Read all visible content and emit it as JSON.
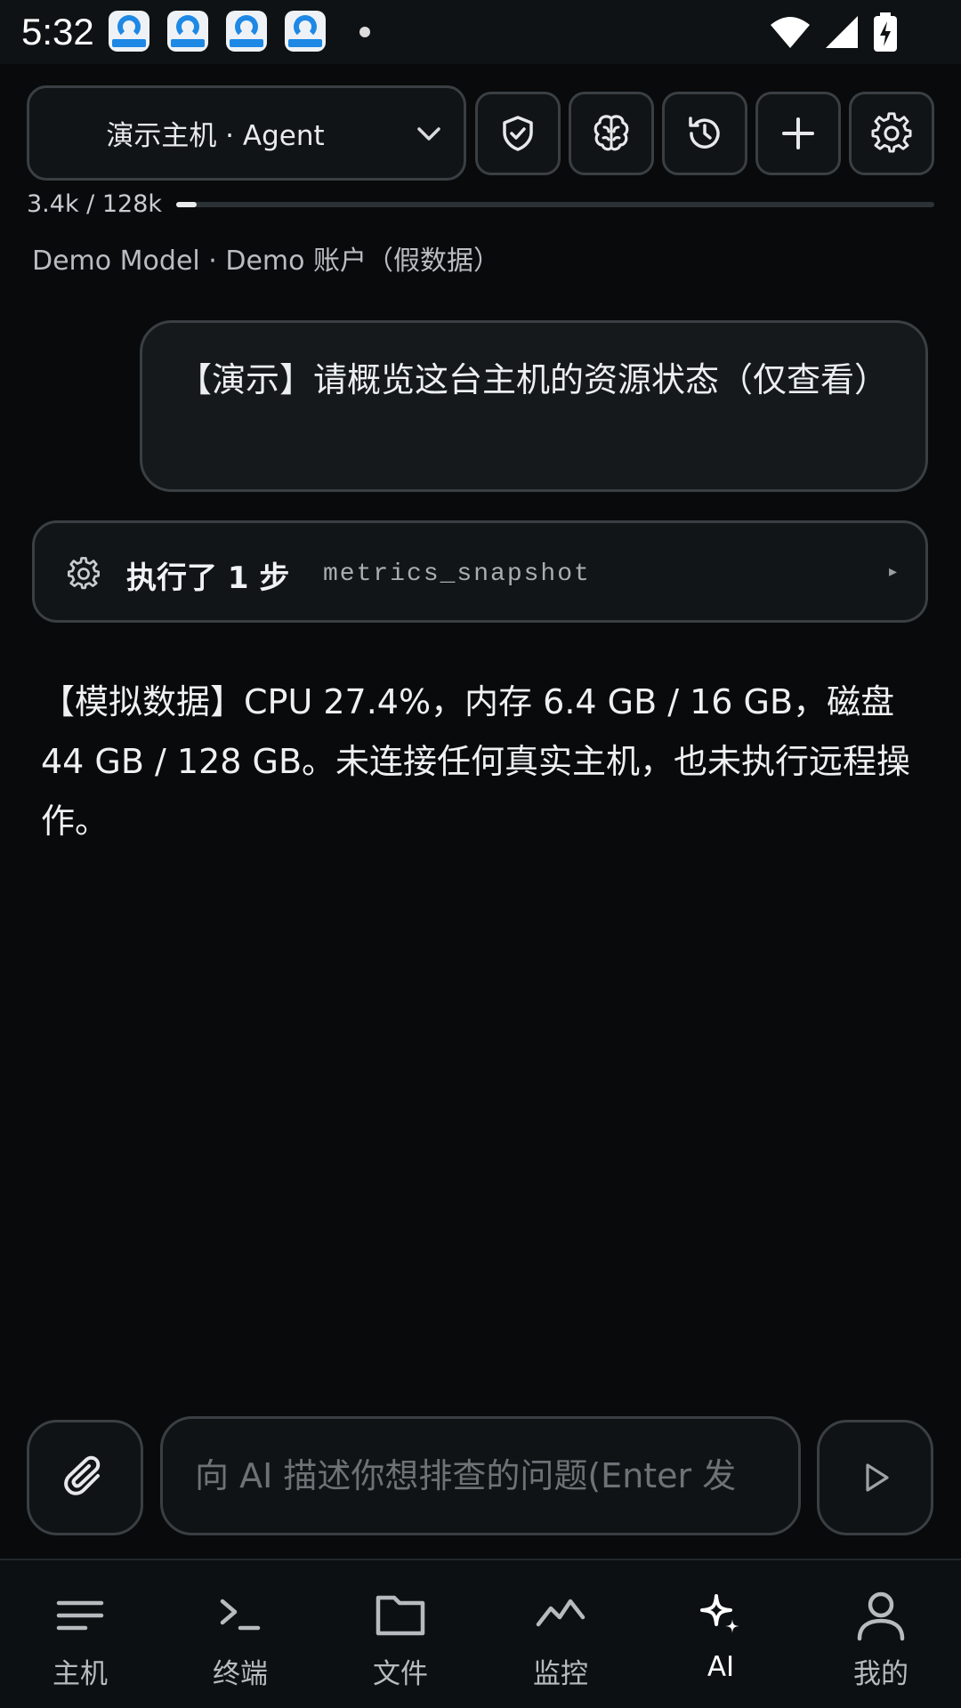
{
  "status_bar": {
    "time": "5:32",
    "notification_icons": [
      "ai-app-icon",
      "ai-app-icon",
      "ai-app-icon",
      "ai-app-icon"
    ],
    "system_icons": [
      "wifi-icon",
      "signal-icon",
      "battery-charging-icon"
    ]
  },
  "header": {
    "host_select_label": "演示主机 · Agent",
    "tools": [
      "shield-icon",
      "brain-icon",
      "history-icon",
      "plus-icon",
      "settings-icon"
    ],
    "usage_text": "3.4k / 128k",
    "usage_fraction": 0.027,
    "model_line": "Demo Model · Demo 账户（假数据）"
  },
  "chat": {
    "user_message": "【演示】请概览这台主机的资源状态（仅查看）",
    "step_title": "执行了 1 步",
    "step_tool": "metrics_snapshot",
    "step_expand_glyph": "▸",
    "ai_reply": "【模拟数据】CPU 27.4%，内存 6.4 GB / 16 GB，磁盘 44 GB / 128 GB。未连接任何真实主机，也未执行远程操作。"
  },
  "composer": {
    "placeholder": "向 AI 描述你想排查的问题(Enter 发",
    "value": ""
  },
  "nav": {
    "items": [
      {
        "label": "主机",
        "icon": "hosts-list-icon"
      },
      {
        "label": "终端",
        "icon": "terminal-icon"
      },
      {
        "label": "文件",
        "icon": "folder-icon"
      },
      {
        "label": "监控",
        "icon": "monitor-chart-icon"
      },
      {
        "label": "AI",
        "icon": "ai-sparkle-icon"
      },
      {
        "label": "我的",
        "icon": "profile-icon"
      }
    ],
    "active": "AI"
  },
  "colors": {
    "background": "#080a0b",
    "border": "#3a3f44",
    "text": "#e6e8ea"
  }
}
